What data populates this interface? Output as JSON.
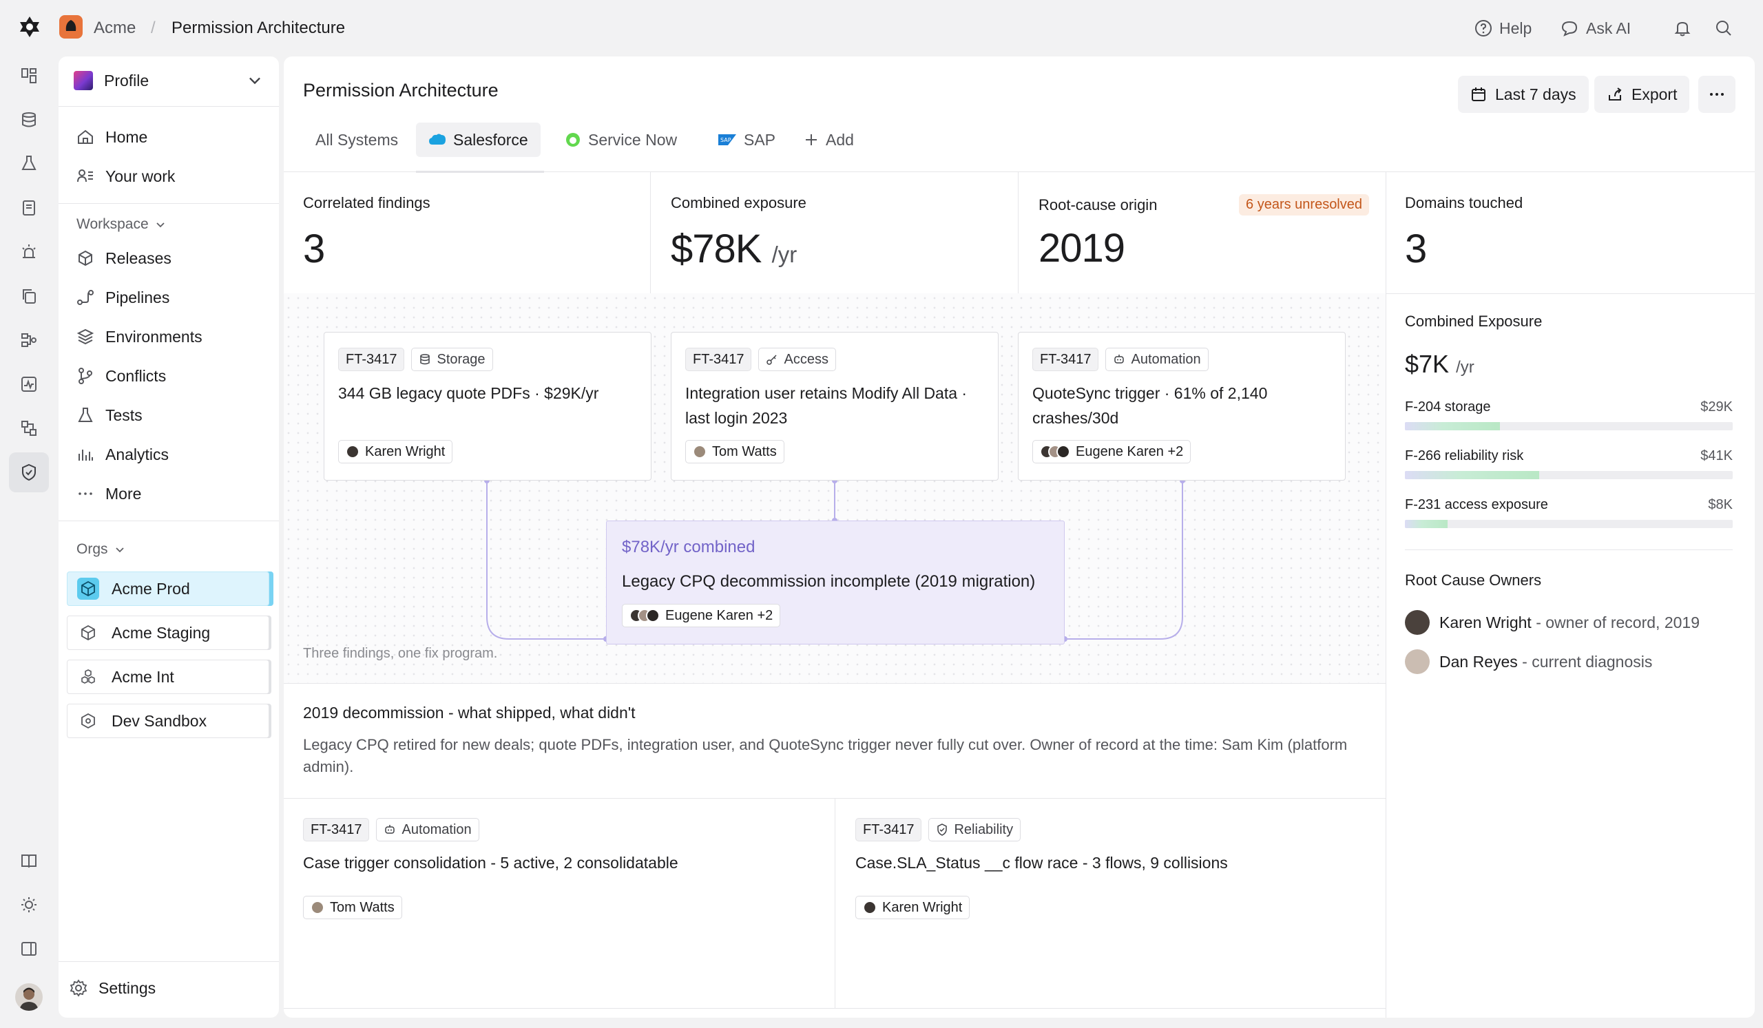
{
  "topbar": {
    "org": "Acme",
    "separator": "/",
    "page": "Permission Architecture",
    "help_label": "Help",
    "ask_ai_label": "Ask AI"
  },
  "sidebar": {
    "profile_label": "Profile",
    "nav": [
      {
        "label": "Home",
        "icon": "home-icon"
      },
      {
        "label": "Your work",
        "icon": "user-list-icon"
      }
    ],
    "workspace_label": "Workspace",
    "workspace_items": [
      {
        "label": "Releases",
        "icon": "box-icon"
      },
      {
        "label": "Pipelines",
        "icon": "pipeline-icon"
      },
      {
        "label": "Environments",
        "icon": "layers-icon"
      },
      {
        "label": "Conflicts",
        "icon": "branch-icon"
      },
      {
        "label": "Tests",
        "icon": "flask-icon"
      },
      {
        "label": "Analytics",
        "icon": "bar-chart-icon"
      },
      {
        "label": "More",
        "icon": "more-icon"
      }
    ],
    "orgs_label": "Orgs",
    "orgs": [
      {
        "label": "Acme Prod",
        "active": true
      },
      {
        "label": "Acme Staging",
        "active": false
      },
      {
        "label": "Acme Int",
        "active": false
      },
      {
        "label": "Dev Sandbox",
        "active": false
      }
    ],
    "settings_label": "Settings"
  },
  "main": {
    "title": "Permission Architecture",
    "date_range_label": "Last 7 days",
    "export_label": "Export",
    "more_label": "···",
    "tabs": [
      {
        "label": "All Systems",
        "active": false
      },
      {
        "label": "Salesforce",
        "active": true
      },
      {
        "label": "Service Now",
        "active": false
      },
      {
        "label": "SAP",
        "active": false
      },
      {
        "label": "Add",
        "active": false
      }
    ],
    "kpis": [
      {
        "label": "Correlated findings",
        "value": "3",
        "unit": ""
      },
      {
        "label": "Combined exposure",
        "value": "$78K",
        "unit": "/yr"
      },
      {
        "label": "Root-cause origin",
        "value": "2019",
        "unit": "",
        "badge": "6 years unresolved"
      },
      {
        "label": "Domains touched",
        "value": "3",
        "unit": ""
      }
    ],
    "findings": [
      {
        "id": "FT-3417",
        "category": "Storage",
        "title": "344 GB legacy quote PDFs · $29K/yr",
        "owner": "Karen Wright"
      },
      {
        "id": "FT-3417",
        "category": "Access",
        "title": "Integration user retains Modify All Data · last login 2023",
        "owner": "Tom Watts"
      },
      {
        "id": "FT-3417",
        "category": "Automation",
        "title": "QuoteSync trigger · 61% of 2,140 crashes/30d",
        "owner": "Eugene Karen +2"
      }
    ],
    "combined": {
      "amount": "$78K/yr combined",
      "title": "Legacy CPQ decommission incomplete (2019 migration)",
      "owner": "Eugene Karen +2"
    },
    "caption": "Three findings, one fix program.",
    "notes": {
      "title": "2019 decommission - what shipped, what didn't",
      "body": "Legacy CPQ retired for new deals; quote PDFs, integration user, and QuoteSync trigger never fully cut over. Owner of record at the time: Sam Kim (platform admin)."
    },
    "related": [
      {
        "id": "FT-3417",
        "category": "Automation",
        "title": "Case trigger consolidation - 5 active, 2 consolidatable",
        "owner": "Tom Watts"
      },
      {
        "id": "FT-3417",
        "category": "Reliability",
        "title": "Case.SLA_Status __c flow race - 3 flows, 9 collisions",
        "owner": "Karen Wright"
      }
    ]
  },
  "right_panel": {
    "exposure_title": "Combined Exposure",
    "exposure_value": "$7K",
    "exposure_unit": "/yr",
    "bars": [
      {
        "label": "F-204 storage",
        "value": "$29K",
        "fraction": 0.29
      },
      {
        "label": "F-266 reliability risk",
        "value": "$41K",
        "fraction": 0.41
      },
      {
        "label": "F-231 access exposure",
        "value": "$8K",
        "fraction": 0.13
      }
    ],
    "owners_title": "Root Cause Owners",
    "owners": [
      {
        "name": "Karen Wright",
        "role": " - owner of record, 2019"
      },
      {
        "name": "Dan Reyes",
        "role": " - current diagnosis"
      }
    ]
  },
  "colors": {
    "accent_purple": "#7263c8",
    "warn": "#c3561a",
    "active_org": "#def4fd",
    "brand": "#e8743b"
  }
}
